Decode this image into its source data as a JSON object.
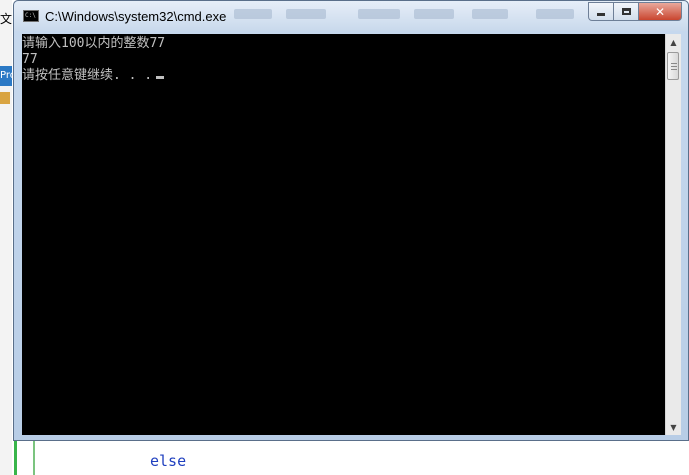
{
  "ide": {
    "left_letter": "文",
    "left_tab": "Pro",
    "code_line": "else",
    "colors": {
      "keyword": "#1f3fbf",
      "change_marker": "#39b54a"
    }
  },
  "window": {
    "title": "C:\\Windows\\system32\\cmd.exe",
    "icon": "cmd-icon",
    "controls": {
      "minimize": "minimize-icon",
      "maximize": "maximize-icon",
      "close": "close-icon"
    }
  },
  "console": {
    "lines": [
      "请输入100以内的整数77",
      "77",
      "请按任意键继续. . ."
    ],
    "colors": {
      "background": "#000000",
      "foreground": "#c0c0c0"
    }
  },
  "scrollbar": {
    "up_icon": "scroll-up-arrow-icon",
    "down_icon": "scroll-down-arrow-icon"
  }
}
